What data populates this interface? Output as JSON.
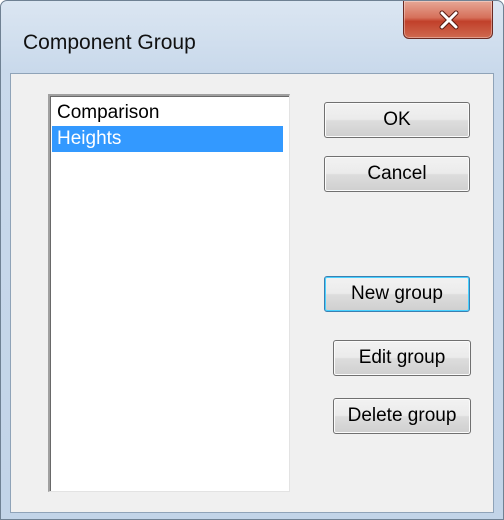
{
  "window": {
    "title": "Component Group"
  },
  "list": {
    "items": [
      {
        "label": "Comparison",
        "selected": false
      },
      {
        "label": "Heights",
        "selected": true
      }
    ]
  },
  "buttons": {
    "ok": "OK",
    "cancel": "Cancel",
    "new_group": "New group",
    "edit_group": "Edit group",
    "delete_group": "Delete group"
  },
  "icons": {
    "close": "close-icon"
  },
  "colors": {
    "selection": "#3399ff",
    "close_button": "#c1402a",
    "default_button_border": "#3c7fb1"
  }
}
